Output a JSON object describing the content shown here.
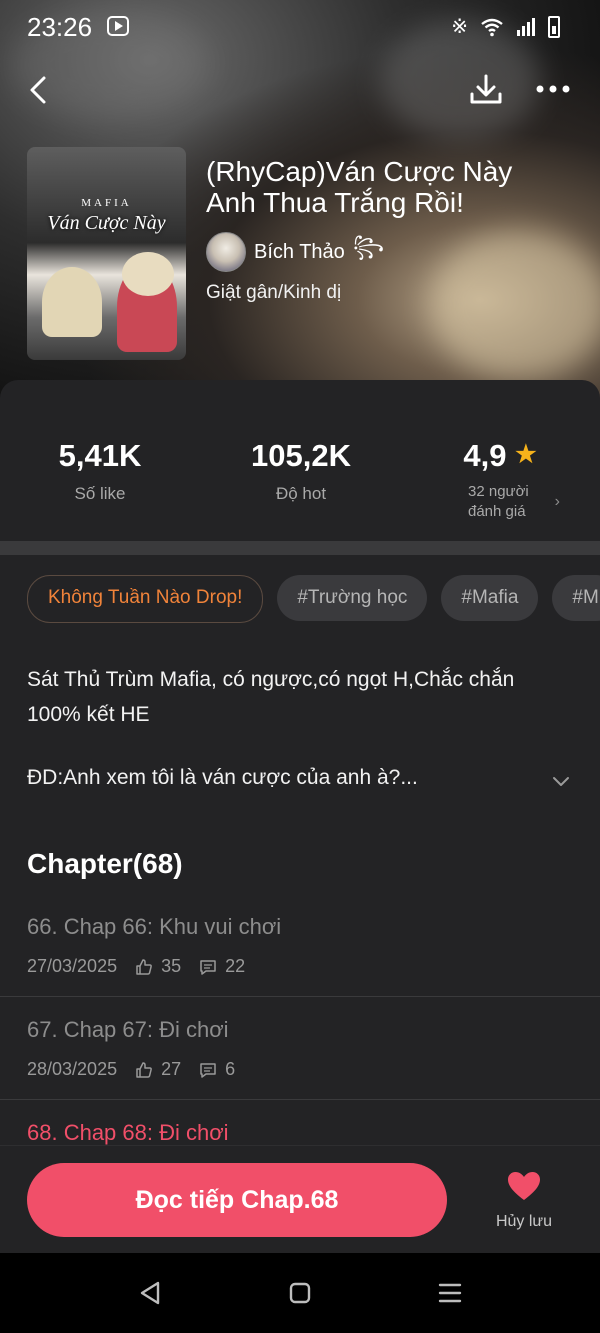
{
  "status_bar": {
    "time": "23:26"
  },
  "story": {
    "title": "(RhyCap)Ván Cược Này Anh Thua Trắng Rồi!",
    "author": "Bích Thảo",
    "author_badge": "꧂",
    "genre": "Giật gân/Kinh dị",
    "cover": {
      "top_text": "MAFIA",
      "title_text": "Ván Cược Này"
    }
  },
  "stats": {
    "likes": {
      "value": "5,41K",
      "label": "Số like"
    },
    "hot": {
      "value": "105,2K",
      "label": "Độ hot"
    },
    "rating": {
      "value": "4,9",
      "sub_line1": "32 người",
      "sub_line2": "đánh giá"
    }
  },
  "tags": [
    "Không Tuần Nào Drop!",
    "#Trường học",
    "#Mafia",
    "#M"
  ],
  "description": "Sát Thủ Trùm Mafia, có ngược,có ngọt H,Chắc chắn 100% kết HE",
  "description_more": "ĐD:Anh xem tôi là ván cược của anh à?...",
  "chapters_header": "Chapter(68)",
  "chapters": [
    {
      "title": "66. Chap 66: Khu vui chơi",
      "date": "27/03/2025",
      "likes": "35",
      "comments": "22"
    },
    {
      "title": "67. Chap 67: Đi chơi",
      "date": "28/03/2025",
      "likes": "27",
      "comments": "6"
    },
    {
      "title": "68. Chap 68: Đi chơi"
    }
  ],
  "bottom": {
    "read_button": "Đọc tiếp Chap.68",
    "unsave_label": "Hủy lưu"
  },
  "colors": {
    "accent": "#f14f69",
    "tag_orange": "#f0833a",
    "star": "#f6b21b"
  }
}
